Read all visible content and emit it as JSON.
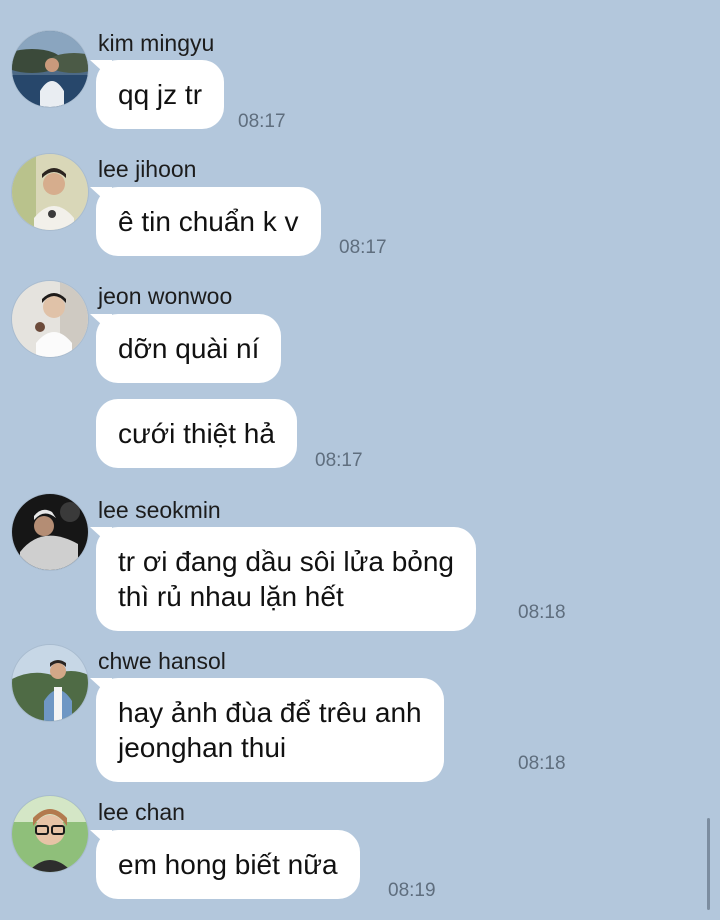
{
  "messages": [
    {
      "sender": "kim mingyu",
      "bubbles": [
        "qq jz tr"
      ],
      "time": "08:17"
    },
    {
      "sender": "lee jihoon",
      "bubbles": [
        "ê tin chuẩn k v"
      ],
      "time": "08:17"
    },
    {
      "sender": "jeon wonwoo",
      "bubbles": [
        "dỡn quài ní",
        "cưới thiệt hả"
      ],
      "time": "08:17"
    },
    {
      "sender": "lee seokmin",
      "bubbles": [
        "tr ơi đang dầu sôi lửa bỏng",
        "thì rủ nhau lặn hết"
      ],
      "time": "08:18"
    },
    {
      "sender": "chwe hansol",
      "bubbles": [
        "hay ảnh đùa để trêu anh",
        "jeonghan thui"
      ],
      "time": "08:18"
    },
    {
      "sender": "lee chan",
      "bubbles": [
        "em hong biết nữa"
      ],
      "time": "08:19"
    }
  ]
}
